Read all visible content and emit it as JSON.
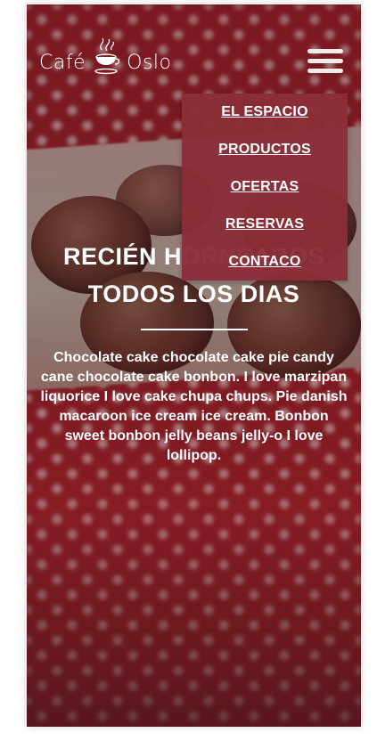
{
  "brand": {
    "name_left": "Café",
    "name_right": "Oslo"
  },
  "nav": {
    "items": [
      {
        "label": "EL ESPACIO"
      },
      {
        "label": "PRODUCTOS"
      },
      {
        "label": "OFERTAS"
      },
      {
        "label": "RESERVAS"
      },
      {
        "label": "CONTACO"
      }
    ]
  },
  "hero": {
    "title_line1": "RECIÉN HORNEADOS",
    "title_line2": "TODOS LOS DIAS",
    "description": "Chocolate cake chocolate cake pie candy cane chocolate cake bonbon. I love marzipan liquorice I love cake chupa chups. Pie danish macaroon ice cream ice cream. Bonbon sweet bonbon jelly beans jelly-o I love lollipop."
  },
  "icons": {
    "menu": "hamburger-menu-icon",
    "logo": "coffee-cup-icon"
  },
  "colors": {
    "menu_bg": "#8a2e38",
    "text": "#ffffff",
    "hamburger": "#f2ece6"
  }
}
